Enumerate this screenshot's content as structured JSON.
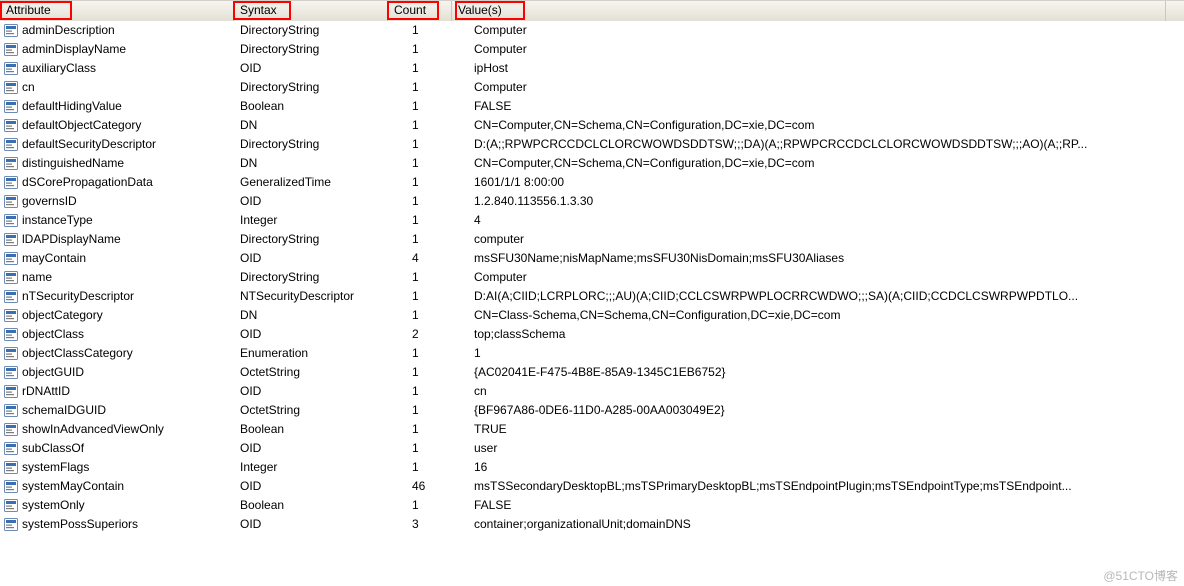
{
  "columns": {
    "attribute": "Attribute",
    "syntax": "Syntax",
    "count": "Count",
    "values": "Value(s)"
  },
  "rows": [
    {
      "attr": "adminDescription",
      "syntax": "DirectoryString",
      "count": "1",
      "value": "Computer"
    },
    {
      "attr": "adminDisplayName",
      "syntax": "DirectoryString",
      "count": "1",
      "value": "Computer"
    },
    {
      "attr": "auxiliaryClass",
      "syntax": "OID",
      "count": "1",
      "value": "ipHost"
    },
    {
      "attr": "cn",
      "syntax": "DirectoryString",
      "count": "1",
      "value": "Computer"
    },
    {
      "attr": "defaultHidingValue",
      "syntax": "Boolean",
      "count": "1",
      "value": "FALSE"
    },
    {
      "attr": "defaultObjectCategory",
      "syntax": "DN",
      "count": "1",
      "value": "CN=Computer,CN=Schema,CN=Configuration,DC=xie,DC=com"
    },
    {
      "attr": "defaultSecurityDescriptor",
      "syntax": "DirectoryString",
      "count": "1",
      "value": "D:(A;;RPWPCRCCDCLCLORCWOWDSDDTSW;;;DA)(A;;RPWPCRCCDCLCLORCWOWDSDDTSW;;;AO)(A;;RP..."
    },
    {
      "attr": "distinguishedName",
      "syntax": "DN",
      "count": "1",
      "value": "CN=Computer,CN=Schema,CN=Configuration,DC=xie,DC=com"
    },
    {
      "attr": "dSCorePropagationData",
      "syntax": "GeneralizedTime",
      "count": "1",
      "value": "1601/1/1 8:00:00"
    },
    {
      "attr": "governsID",
      "syntax": "OID",
      "count": "1",
      "value": "1.2.840.113556.1.3.30"
    },
    {
      "attr": "instanceType",
      "syntax": "Integer",
      "count": "1",
      "value": "4"
    },
    {
      "attr": "lDAPDisplayName",
      "syntax": "DirectoryString",
      "count": "1",
      "value": "computer"
    },
    {
      "attr": "mayContain",
      "syntax": "OID",
      "count": "4",
      "value": "msSFU30Name;nisMapName;msSFU30NisDomain;msSFU30Aliases"
    },
    {
      "attr": "name",
      "syntax": "DirectoryString",
      "count": "1",
      "value": "Computer"
    },
    {
      "attr": "nTSecurityDescriptor",
      "syntax": "NTSecurityDescriptor",
      "count": "1",
      "value": "D:AI(A;CIID;LCRPLORC;;;AU)(A;CIID;CCLCSWRPWPLOCRRCWDWO;;;SA)(A;CIID;CCDCLCSWRPWPDTLO..."
    },
    {
      "attr": "objectCategory",
      "syntax": "DN",
      "count": "1",
      "value": "CN=Class-Schema,CN=Schema,CN=Configuration,DC=xie,DC=com"
    },
    {
      "attr": "objectClass",
      "syntax": "OID",
      "count": "2",
      "value": "top;classSchema"
    },
    {
      "attr": "objectClassCategory",
      "syntax": "Enumeration",
      "count": "1",
      "value": "1"
    },
    {
      "attr": "objectGUID",
      "syntax": "OctetString",
      "count": "1",
      "value": "{AC02041E-F475-4B8E-85A9-1345C1EB6752}"
    },
    {
      "attr": "rDNAttID",
      "syntax": "OID",
      "count": "1",
      "value": "cn"
    },
    {
      "attr": "schemaIDGUID",
      "syntax": "OctetString",
      "count": "1",
      "value": "{BF967A86-0DE6-11D0-A285-00AA003049E2}"
    },
    {
      "attr": "showInAdvancedViewOnly",
      "syntax": "Boolean",
      "count": "1",
      "value": "TRUE"
    },
    {
      "attr": "subClassOf",
      "syntax": "OID",
      "count": "1",
      "value": "user"
    },
    {
      "attr": "systemFlags",
      "syntax": "Integer",
      "count": "1",
      "value": "16"
    },
    {
      "attr": "systemMayContain",
      "syntax": "OID",
      "count": "46",
      "value": "msTSSecondaryDesktopBL;msTSPrimaryDesktopBL;msTSEndpointPlugin;msTSEndpointType;msTSEndpoint..."
    },
    {
      "attr": "systemOnly",
      "syntax": "Boolean",
      "count": "1",
      "value": "FALSE"
    },
    {
      "attr": "systemPossSuperiors",
      "syntax": "OID",
      "count": "3",
      "value": "container;organizationalUnit;domainDNS"
    }
  ],
  "watermark": "@51CTO博客"
}
